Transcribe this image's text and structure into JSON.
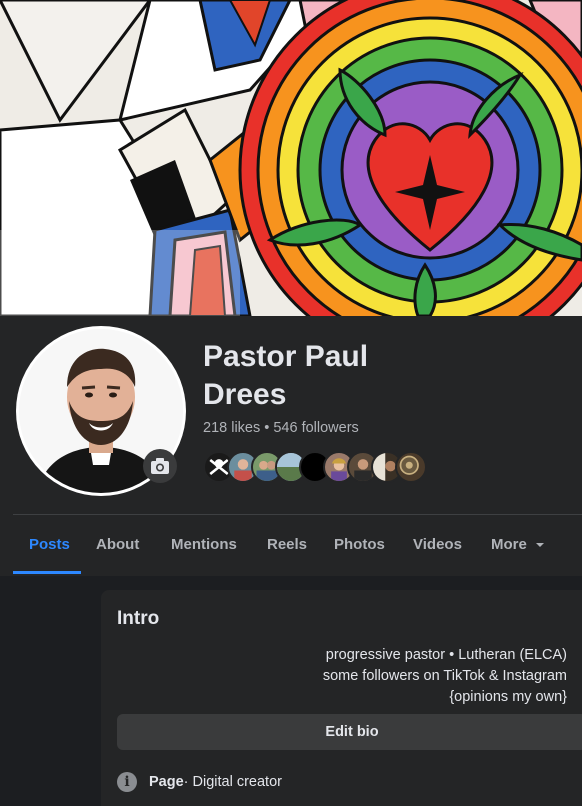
{
  "profile": {
    "name": "Pastor Paul Drees",
    "stats": "218 likes • 546 followers"
  },
  "tabs": [
    {
      "label": "Posts"
    },
    {
      "label": "About"
    },
    {
      "label": "Mentions"
    },
    {
      "label": "Reels"
    },
    {
      "label": "Photos"
    },
    {
      "label": "Videos"
    },
    {
      "label": "More"
    }
  ],
  "intro": {
    "title": "Intro",
    "bio_lines": [
      "progressive pastor • Lutheran (ELCA)",
      "some followers on TikTok & Instagram",
      "{opinions my own}"
    ],
    "edit_bio_label": "Edit bio",
    "page_label": "Page",
    "page_category": " · Digital creator"
  },
  "colors": {
    "accent": "#2d88ff",
    "background": "#1c1e21",
    "card": "#242526",
    "secondary_text": "#b0b3b8"
  },
  "icons": {
    "camera": "camera-icon",
    "more": "caret-down-icon",
    "info": "info-icon"
  }
}
